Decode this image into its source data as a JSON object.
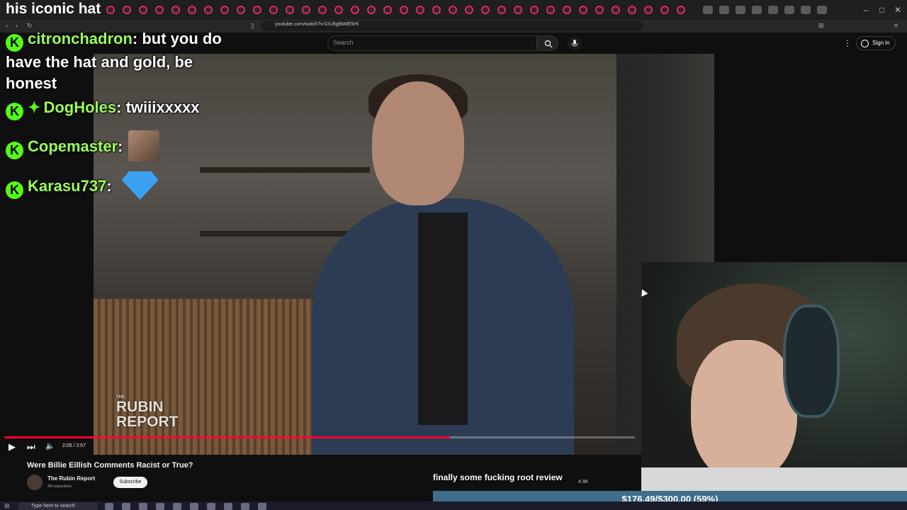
{
  "browser": {
    "tab_title": "his iconic hat",
    "tab_count_hint": "multiple",
    "url": "youtube.com/watch?v=DU8gBWiE5HI",
    "window_controls": [
      "–",
      "□",
      "✕"
    ]
  },
  "youtube": {
    "search_placeholder": "Search",
    "sign_in_label": "Sign in",
    "video_title": "Were Billie Eillish Comments Racist or True?",
    "channel_name": "The Rubin Report",
    "subscribers": "3M subscribers",
    "subscribe_label": "Subscribe",
    "time_display": "2:05 / 2:57",
    "progress": 0.707,
    "likes": "4.9K",
    "watermark_top": "THE",
    "watermark_main": "RUBIN REPORT"
  },
  "chat": {
    "messages": [
      {
        "user": "citronchadron",
        "text": "but you do have the hat and gold, be honest"
      },
      {
        "user": "DogHoles",
        "text": "twiiixxxxx"
      },
      {
        "user": "Copemaster",
        "text": ""
      },
      {
        "user": "Karasu737",
        "text": ""
      }
    ],
    "badge_letter": "K"
  },
  "overlay": {
    "caption": "finally some fucking root review",
    "donation_goal": "$176.49/$300.00 (59%)"
  },
  "taskbar": {
    "search_placeholder": "Type here to search"
  }
}
